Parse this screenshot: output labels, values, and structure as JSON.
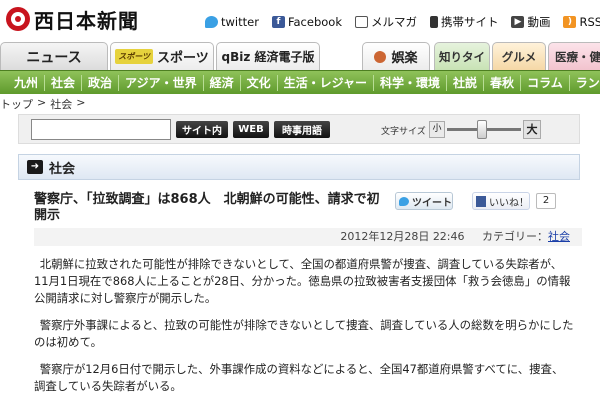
{
  "header": {
    "logo_text": "西日本新聞",
    "links": [
      {
        "label": "twitter",
        "icon": "twitter-icon"
      },
      {
        "label": "Facebook",
        "icon": "facebook-icon"
      },
      {
        "label": "メルマガ",
        "icon": "mail-icon"
      },
      {
        "label": "携帯サイト",
        "icon": "phone-icon"
      },
      {
        "label": "動画",
        "icon": "video-icon"
      },
      {
        "label": "RSS",
        "icon": "rss-icon"
      }
    ]
  },
  "tabs": {
    "news": "ニュース",
    "sports_badge": "スポーツ",
    "sports": "スポーツ",
    "qbiz": "qBiz 経済電子版",
    "goraku": "娯楽",
    "shiritai": "知りタイ",
    "gurume": "グルメ",
    "iryou": "医療・健"
  },
  "categories": [
    "九州",
    "社会",
    "政治",
    "アジア・世界",
    "経済",
    "文化",
    "生活・レジャー",
    "科学・環境",
    "社説",
    "春秋",
    "コラム",
    "ランキ"
  ],
  "breadcrumb": {
    "top": "トップ",
    "sep1": ">",
    "current": "社会",
    "sep2": ">"
  },
  "search": {
    "placeholder": "",
    "btn_site": "サイト内",
    "btn_web": "WEB",
    "btn_jiji": "時事用語",
    "fontsize_label": "文字サイズ",
    "fs_small": "小",
    "fs_large": "大"
  },
  "section": {
    "title": "社会"
  },
  "article": {
    "headline": "警察庁、「拉致調査」は868人　北朝鮮の可能性、請求で初開示",
    "tweet": "ツイート",
    "like": "いいね！",
    "like_count": "2",
    "date": "2012年12月28日 22:46",
    "category_label": "カテゴリー：",
    "category": "社会",
    "paragraphs": [
      "北朝鮮に拉致された可能性が排除できないとして、全国の都道府県警が捜査、調査している失踪者が、11月1日現在で868人に上ることが28日、分かった。徳島県の拉致被害者支援団体「救う会徳島」の情報公開請求に対し警察庁が開示した。",
      "警察庁外事課によると、拉致の可能性が排除できないとして捜査、調査している人の総数を明らかにしたのは初めて。",
      "警察庁が12月6日付で開示した、外事課作成の資料などによると、全国47都道府県警すべてに、捜査、調査している失踪者がいる。"
    ]
  }
}
